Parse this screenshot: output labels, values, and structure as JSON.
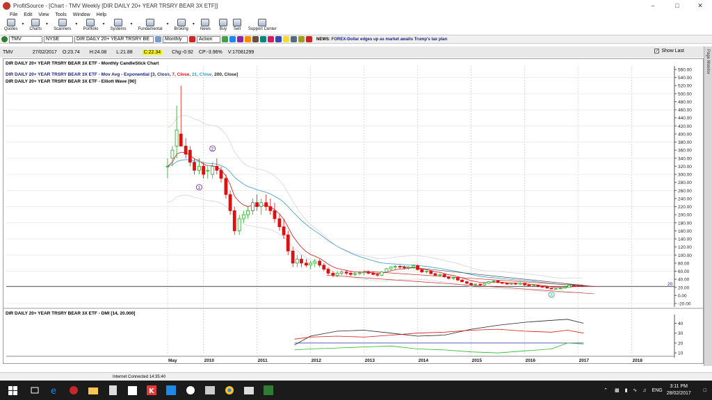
{
  "window": {
    "app_name": "ProfitSource",
    "title": "ProfitSource - [Chart - TMV Weekly [DIR DAILY 20+ YEAR TRSRY BEAR 3X ETF]]"
  },
  "menu": [
    "File",
    "Edit",
    "View",
    "Tools",
    "Window",
    "Help"
  ],
  "toolbar": [
    {
      "label": "Quotes",
      "icon": "quotes-icon"
    },
    {
      "label": "Charts",
      "icon": "charts-icon"
    },
    {
      "label": "Scanners",
      "icon": "scanners-icon"
    },
    {
      "label": "Portfolio",
      "icon": "portfolio-icon"
    },
    {
      "label": "Systems",
      "icon": "systems-icon"
    },
    {
      "label": "Fundamental",
      "icon": "fundamental-icon"
    },
    {
      "label": "Broking",
      "icon": "broking-icon"
    },
    {
      "label": "News",
      "icon": "news-icon"
    },
    {
      "label": "Buy",
      "icon": "buy-icon"
    },
    {
      "label": "Sell",
      "icon": "sell-icon"
    },
    {
      "label": "Support Center",
      "icon": "support-center-icon"
    }
  ],
  "symbol_bar": {
    "symbol": "TMV",
    "exchange": "NYSE",
    "name": "DIR DAILY 20+ YEAR TRSRY BE",
    "period": "Monthly",
    "action": "Action",
    "news_prefix": "NEWS:",
    "news_text": "FOREX-Dollar edges up as market awaits Trump's tax plan"
  },
  "quote": {
    "symbol": "TMV",
    "date": "27/02/2017",
    "open": "O:23.74",
    "high": "H:24.08",
    "low": "L:21.88",
    "close": "C:22.34",
    "change": "Chg:-0.92",
    "change_pct": "CP:-3.96%",
    "volume": "V:17081299",
    "show_last": "Show Last"
  },
  "page_monitor": "Page Monitor",
  "status": {
    "text": "Internet Connected 14:35:40"
  },
  "taskbar": {
    "time": "3:11 PM",
    "date": "28/02/2017",
    "lang": "ENG"
  },
  "colors": {
    "up": "#22aa22",
    "down": "#dd1111",
    "ema3": "#dd1111",
    "ema21": "#3399cc",
    "ema200": "#222222",
    "dmi_plus": "#22bb22",
    "dmi_minus": "#dd1111",
    "adx": "#222222"
  },
  "chart_data": [
    {
      "type": "candlestick",
      "title": "DIR DAILY 20+ YEAR TRSRY BEAR 3X ETF - Monthly CandleStick Chart",
      "indicator_label": "DIR DAILY 20+ YEAR TRSRY BEAR 3X ETF - Mov Avg - Exponential [3, Close, 7, Close, 21, Close, 200, Close]",
      "indicator_parts": [
        {
          "text": "DIR DAILY 20+ YEAR TRSRY BEAR 3X ETF - Mov Avg - Exponential [",
          "color": "#1a237e"
        },
        {
          "text": "3, Close, ",
          "color": "#1a237e"
        },
        {
          "text": "7, Close, ",
          "color": "#dd1111"
        },
        {
          "text": "21, Close, ",
          "color": "#3399cc"
        },
        {
          "text": "200, Close",
          "color": "#222222"
        },
        {
          "text": "]",
          "color": "#1a237e"
        }
      ],
      "wave_label": "DIR DAILY 20+ YEAR TRSRY BEAR 3X ETF - Elliott Wave [90]",
      "x_ticks": [
        "May",
        "2010",
        "2011",
        "2012",
        "2013",
        "2014",
        "2015",
        "2016",
        "2017",
        "2018"
      ],
      "y_ticks": [
        "560.00",
        "540.00",
        "520.00",
        "500.00",
        "480.00",
        "460.00",
        "440.00",
        "420.00",
        "400.00",
        "380.00",
        "360.00",
        "340.00",
        "320.00",
        "300.00",
        "280.00",
        "260.00",
        "240.00",
        "220.00",
        "200.00",
        "180.00",
        "160.00",
        "140.00",
        "120.00",
        "100.00",
        "80.00",
        "60.00",
        "40.00",
        "20.00",
        "0.00",
        "-20.00"
      ],
      "ylim": [
        -20,
        560
      ],
      "last_price_label": "20",
      "last_price": 22.34,
      "wave_labels": [
        "1",
        "2",
        "3"
      ],
      "candles": [
        [
          2009.33,
          320,
          340,
          290,
          320
        ],
        [
          2009.42,
          340,
          370,
          320,
          360
        ],
        [
          2009.5,
          370,
          470,
          340,
          410
        ],
        [
          2009.58,
          400,
          520,
          380,
          370
        ],
        [
          2009.67,
          370,
          390,
          340,
          350
        ],
        [
          2009.75,
          360,
          370,
          320,
          330
        ],
        [
          2009.83,
          330,
          340,
          300,
          310
        ],
        [
          2009.92,
          310,
          340,
          300,
          320
        ],
        [
          2010.0,
          320,
          330,
          290,
          300
        ],
        [
          2010.08,
          310,
          320,
          290,
          310
        ],
        [
          2010.17,
          300,
          330,
          290,
          320
        ],
        [
          2010.25,
          320,
          340,
          300,
          310
        ],
        [
          2010.33,
          310,
          320,
          280,
          290
        ],
        [
          2010.42,
          290,
          300,
          240,
          250
        ],
        [
          2010.5,
          250,
          260,
          200,
          210
        ],
        [
          2010.58,
          210,
          220,
          150,
          160
        ],
        [
          2010.67,
          160,
          200,
          150,
          190
        ],
        [
          2010.75,
          190,
          210,
          180,
          200
        ],
        [
          2010.83,
          200,
          220,
          190,
          210
        ],
        [
          2010.92,
          210,
          240,
          200,
          230
        ],
        [
          2011.0,
          230,
          250,
          210,
          220
        ],
        [
          2011.08,
          220,
          240,
          200,
          230
        ],
        [
          2011.17,
          230,
          250,
          210,
          220
        ],
        [
          2011.25,
          220,
          240,
          200,
          210
        ],
        [
          2011.33,
          210,
          230,
          180,
          190
        ],
        [
          2011.42,
          190,
          200,
          160,
          170
        ],
        [
          2011.5,
          170,
          190,
          140,
          150
        ],
        [
          2011.58,
          150,
          160,
          100,
          110
        ],
        [
          2011.67,
          110,
          120,
          70,
          80
        ],
        [
          2011.75,
          80,
          100,
          70,
          90
        ],
        [
          2011.83,
          90,
          100,
          70,
          80
        ],
        [
          2011.92,
          80,
          90,
          70,
          75
        ],
        [
          2012.0,
          75,
          85,
          65,
          80
        ],
        [
          2012.08,
          80,
          90,
          70,
          85
        ],
        [
          2012.17,
          85,
          90,
          70,
          75
        ],
        [
          2012.25,
          75,
          80,
          60,
          65
        ],
        [
          2012.33,
          65,
          70,
          50,
          55
        ],
        [
          2012.42,
          55,
          60,
          45,
          50
        ],
        [
          2012.5,
          50,
          60,
          45,
          55
        ],
        [
          2012.58,
          55,
          62,
          50,
          58
        ],
        [
          2012.67,
          58,
          62,
          50,
          55
        ],
        [
          2012.75,
          55,
          60,
          48,
          52
        ],
        [
          2012.83,
          52,
          58,
          48,
          54
        ],
        [
          2012.92,
          54,
          60,
          50,
          56
        ],
        [
          2013.0,
          56,
          62,
          50,
          58
        ],
        [
          2013.08,
          58,
          62,
          52,
          55
        ],
        [
          2013.17,
          55,
          60,
          50,
          52
        ],
        [
          2013.25,
          52,
          56,
          46,
          50
        ],
        [
          2013.33,
          50,
          60,
          48,
          58
        ],
        [
          2013.42,
          58,
          68,
          56,
          66
        ],
        [
          2013.5,
          66,
          72,
          62,
          70
        ],
        [
          2013.58,
          70,
          75,
          64,
          72
        ],
        [
          2013.67,
          72,
          76,
          66,
          70
        ],
        [
          2013.75,
          70,
          74,
          64,
          68
        ],
        [
          2013.83,
          68,
          72,
          64,
          70
        ],
        [
          2013.92,
          70,
          76,
          66,
          74
        ],
        [
          2014.0,
          74,
          76,
          62,
          64
        ],
        [
          2014.08,
          64,
          66,
          56,
          58
        ],
        [
          2014.17,
          58,
          62,
          54,
          60
        ],
        [
          2014.25,
          60,
          62,
          52,
          54
        ],
        [
          2014.33,
          54,
          56,
          48,
          50
        ],
        [
          2014.42,
          50,
          54,
          46,
          52
        ],
        [
          2014.5,
          52,
          54,
          44,
          46
        ],
        [
          2014.58,
          46,
          48,
          40,
          42
        ],
        [
          2014.67,
          42,
          46,
          38,
          44
        ],
        [
          2014.75,
          44,
          46,
          36,
          38
        ],
        [
          2014.83,
          38,
          40,
          32,
          34
        ],
        [
          2014.92,
          34,
          36,
          28,
          30
        ],
        [
          2015.0,
          30,
          32,
          24,
          26
        ],
        [
          2015.08,
          26,
          30,
          24,
          28
        ],
        [
          2015.17,
          28,
          30,
          24,
          26
        ],
        [
          2015.25,
          26,
          32,
          24,
          30
        ],
        [
          2015.33,
          30,
          36,
          28,
          34
        ],
        [
          2015.42,
          34,
          38,
          30,
          36
        ],
        [
          2015.5,
          36,
          38,
          30,
          32
        ],
        [
          2015.58,
          32,
          34,
          28,
          30
        ],
        [
          2015.67,
          30,
          32,
          26,
          28
        ],
        [
          2015.75,
          28,
          32,
          26,
          30
        ],
        [
          2015.83,
          30,
          32,
          26,
          28
        ],
        [
          2015.92,
          28,
          32,
          26,
          30
        ],
        [
          2016.0,
          30,
          32,
          24,
          26
        ],
        [
          2016.08,
          26,
          28,
          22,
          24
        ],
        [
          2016.17,
          24,
          26,
          22,
          25
        ],
        [
          2016.25,
          25,
          26,
          20,
          22
        ],
        [
          2016.33,
          22,
          24,
          19,
          21
        ],
        [
          2016.42,
          21,
          22,
          17,
          18
        ],
        [
          2016.5,
          18,
          19,
          15,
          16
        ],
        [
          2016.58,
          16,
          18,
          15,
          17
        ],
        [
          2016.67,
          17,
          19,
          16,
          18
        ],
        [
          2016.75,
          18,
          21,
          17,
          20
        ],
        [
          2016.83,
          20,
          26,
          19,
          25
        ],
        [
          2016.92,
          25,
          27,
          23,
          24
        ],
        [
          2017.0,
          24,
          25,
          22,
          23
        ],
        [
          2017.08,
          23.74,
          24.08,
          21.88,
          22.34
        ]
      ]
    },
    {
      "type": "line",
      "title": "DIR DAILY 20+ YEAR TRSRY BEAR 3X ETF - DMI [14, 20.000]",
      "y_ticks": [
        "40",
        "30",
        "20",
        "10"
      ],
      "ylim": [
        8,
        46
      ],
      "threshold": 20,
      "x": [
        2011.7,
        2012.0,
        2012.5,
        2013.0,
        2013.5,
        2014.0,
        2014.5,
        2015.0,
        2015.5,
        2016.0,
        2016.5,
        2016.8,
        2017.1
      ],
      "series": [
        {
          "values": [
            18,
            27,
            32,
            33,
            30,
            27,
            28,
            34,
            38,
            41,
            43,
            44,
            40
          ]
        },
        {
          "values": [
            24,
            26,
            27,
            26,
            28,
            30,
            31,
            33,
            34,
            32,
            31,
            33,
            30
          ]
        },
        {
          "values": [
            13,
            14,
            15,
            16,
            17,
            14,
            13,
            11,
            10,
            12,
            14,
            20,
            19
          ]
        }
      ]
    }
  ]
}
